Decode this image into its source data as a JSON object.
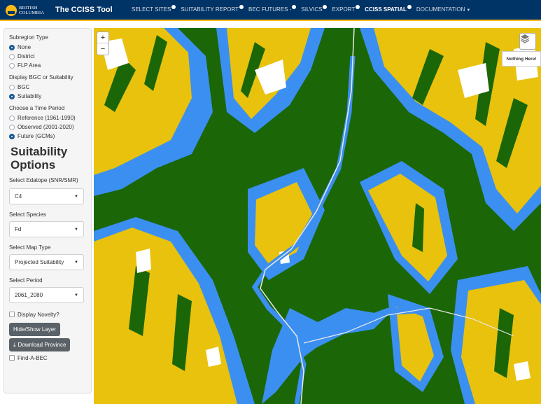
{
  "header": {
    "logo_line1": "BRITISH",
    "logo_line2": "COLUMBIA",
    "app_title": "The CCISS Tool",
    "nav": [
      {
        "label": "SELECT SITES"
      },
      {
        "label": "SUITABILITY REPORT"
      },
      {
        "label": "BEC FUTURES -"
      },
      {
        "label": "SILVICS"
      },
      {
        "label": "EXPORT"
      },
      {
        "label": "CCISS SPATIAL"
      },
      {
        "label": "DOCUMENTATION"
      }
    ]
  },
  "sidebar": {
    "subregion_label": "Subregion Type",
    "subregion_options": [
      "None",
      "District",
      "FLP Area"
    ],
    "display_label": "Display BGC or Suitability",
    "display_options": [
      "BGC",
      "Suitability"
    ],
    "period_label": "Choose a Time Period",
    "period_options": [
      "Reference (1961-1990)",
      "Observed (2001-2020)",
      "Future (GCMs)"
    ],
    "options_heading": "Suitability Options",
    "edatope_label": "Select Edatope (SNR/SMR)",
    "edatope_value": "C4",
    "species_label": "Select Species",
    "species_value": "Fd",
    "maptype_label": "Select Map Type",
    "maptype_value": "Projected Suitability",
    "period_select_label": "Select Period",
    "period_select_value": "2061_2080",
    "novelty_label": "Display Novelty?",
    "hide_show_label": "Hide/Show Layer",
    "download_label": "Download Province",
    "find_bec_label": "Find-A-BEC"
  },
  "map": {
    "zoom_in": "+",
    "zoom_out": "−",
    "tooltip": "Nothing Here!",
    "colors": {
      "forest": "#1b6607",
      "gold": "#e8c20d",
      "blue": "#3b8ff0",
      "white": "#ffffff"
    }
  }
}
